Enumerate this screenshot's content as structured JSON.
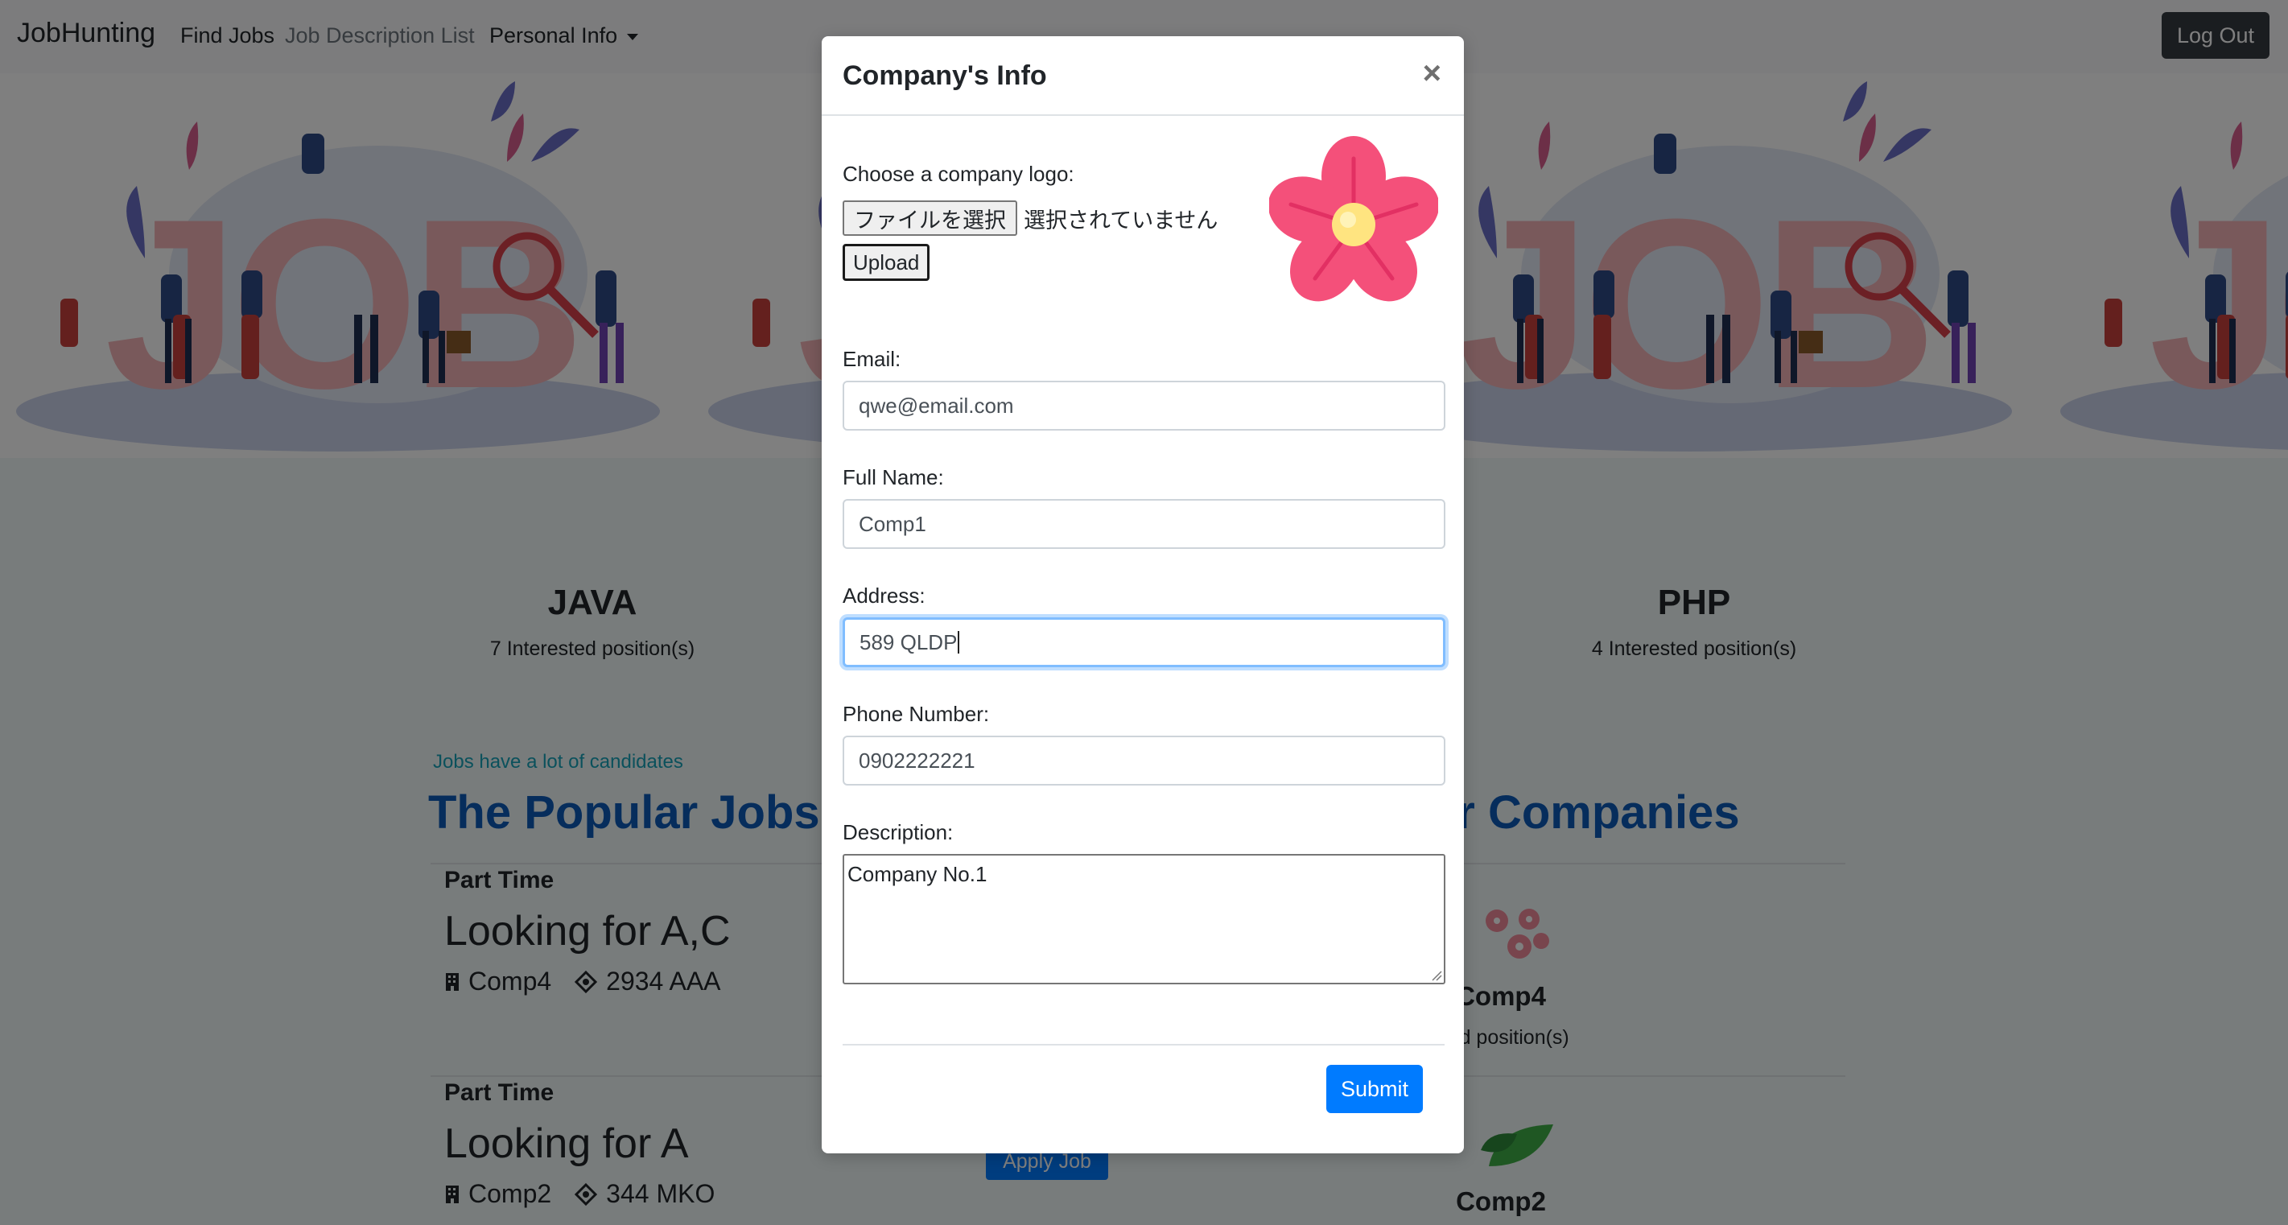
{
  "navbar": {
    "brand": "JobHunting",
    "find_jobs": "Find Jobs",
    "job_description_list": "Job Description List",
    "personal_info": "Personal Info",
    "logout": "Log Out"
  },
  "skills": [
    {
      "name": "JAVA",
      "count_text": "7 Interested position(s)"
    },
    {
      "name": "PHP",
      "count_text": "4 Interested position(s)"
    }
  ],
  "popular": {
    "hint": "Jobs have a lot of candidates",
    "jobs_title": "The Popular Jobs",
    "companies_title_visible": "ar Companies"
  },
  "jobs": [
    {
      "type": "Part Time",
      "title": "Looking for A,C",
      "company": "Comp4",
      "address": "2934 AAA"
    },
    {
      "type": "Part Time",
      "title": "Looking for A",
      "company": "Comp2",
      "address": "344 MKO",
      "apply_label": "Apply Job"
    }
  ],
  "companies": [
    {
      "name_visible": "Comp4",
      "count_visible": "sted position(s)"
    },
    {
      "name_visible": "Comp2"
    }
  ],
  "modal": {
    "title": "Company's Info",
    "close": "×",
    "logo_label": "Choose a company logo:",
    "file_button": "ファイルを選択",
    "file_status": "選択されていません",
    "upload": "Upload",
    "email_label": "Email:",
    "email_value": "qwe@email.com",
    "fullname_label": "Full Name:",
    "fullname_value": "Comp1",
    "address_label": "Address:",
    "address_value": "589 QLDP",
    "phone_label": "Phone Number:",
    "phone_value": "0902222221",
    "description_label": "Description:",
    "description_value": "Company No.1",
    "submit": "Submit"
  },
  "colors": {
    "primary": "#007bff",
    "dark_button": "#343a40",
    "title_blue": "#0d5ab8",
    "hint_teal": "#17a2b8",
    "backdrop": "rgba(0,0,0,0.5)"
  },
  "icons": [
    "building-icon",
    "location-icon",
    "close-icon",
    "caret-down-icon",
    "flower-logo-icon",
    "leaf-logo-icon"
  ]
}
